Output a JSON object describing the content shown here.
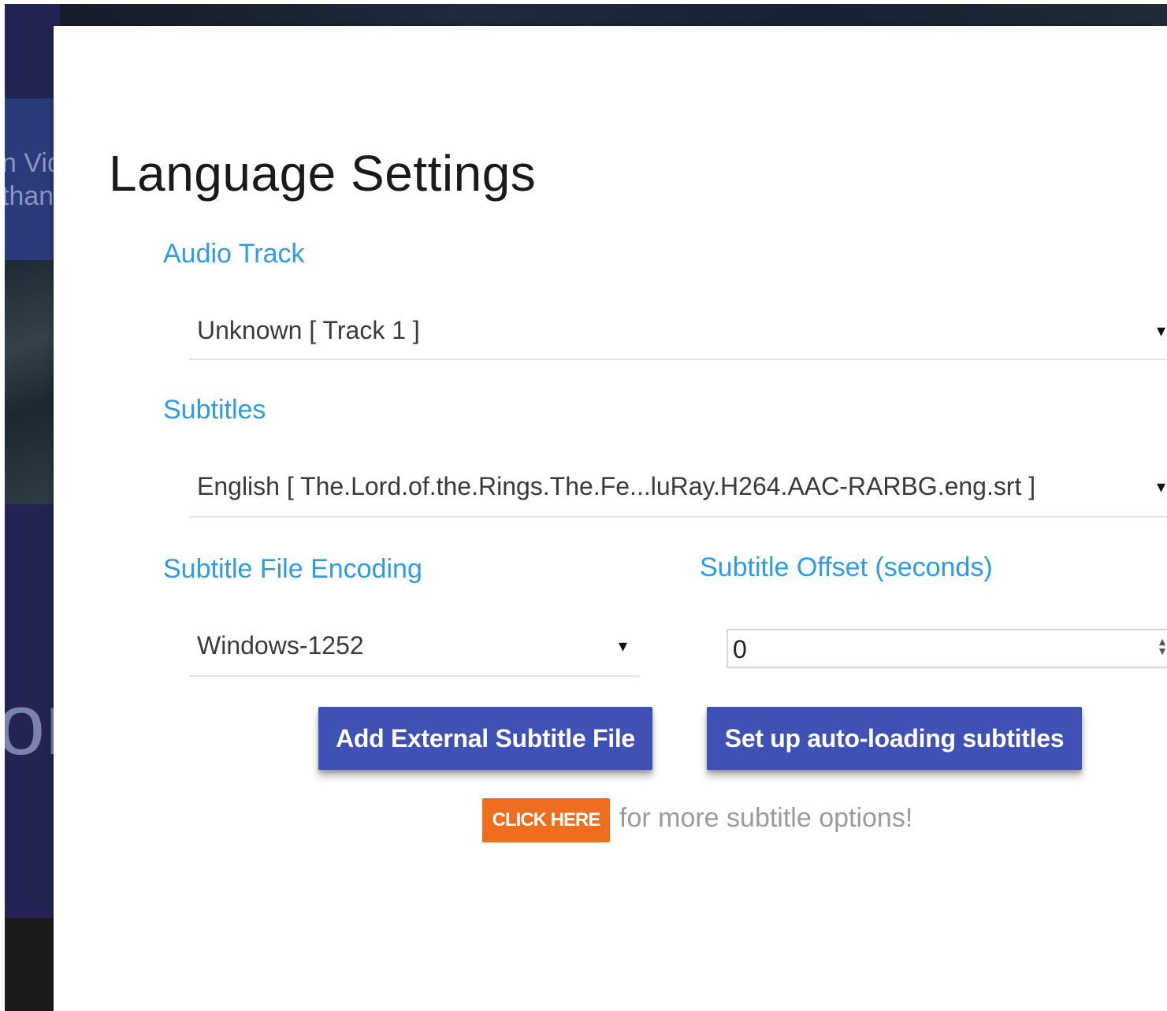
{
  "background": {
    "header_line1": "n Vid",
    "header_line2": "than",
    "big_text": "or"
  },
  "modal": {
    "title": "Language Settings",
    "audio_track": {
      "label": "Audio Track",
      "value": "Unknown [ Track 1 ]"
    },
    "subtitles": {
      "label": "Subtitles",
      "value": "English [ The.Lord.of.the.Rings.The.Fe...luRay.H264.AAC-RARBG.eng.srt ]"
    },
    "encoding": {
      "label": "Subtitle File Encoding",
      "value": "Windows-1252"
    },
    "offset": {
      "label": "Subtitle Offset (seconds)",
      "value": "0"
    },
    "buttons": {
      "add_external": "Add External Subtitle File",
      "auto_loading": "Set up auto-loading subtitles"
    },
    "promo": {
      "click_here": "CLICK HERE",
      "text": "for more subtitle options!"
    },
    "icons": {
      "caret": "▾",
      "spinner_up": "▲",
      "spinner_down": "▼"
    },
    "colors": {
      "label": "#2e9be8",
      "button": "#3f51b5",
      "click_here": "#ee6d1e",
      "backdrop": "#232453"
    }
  }
}
